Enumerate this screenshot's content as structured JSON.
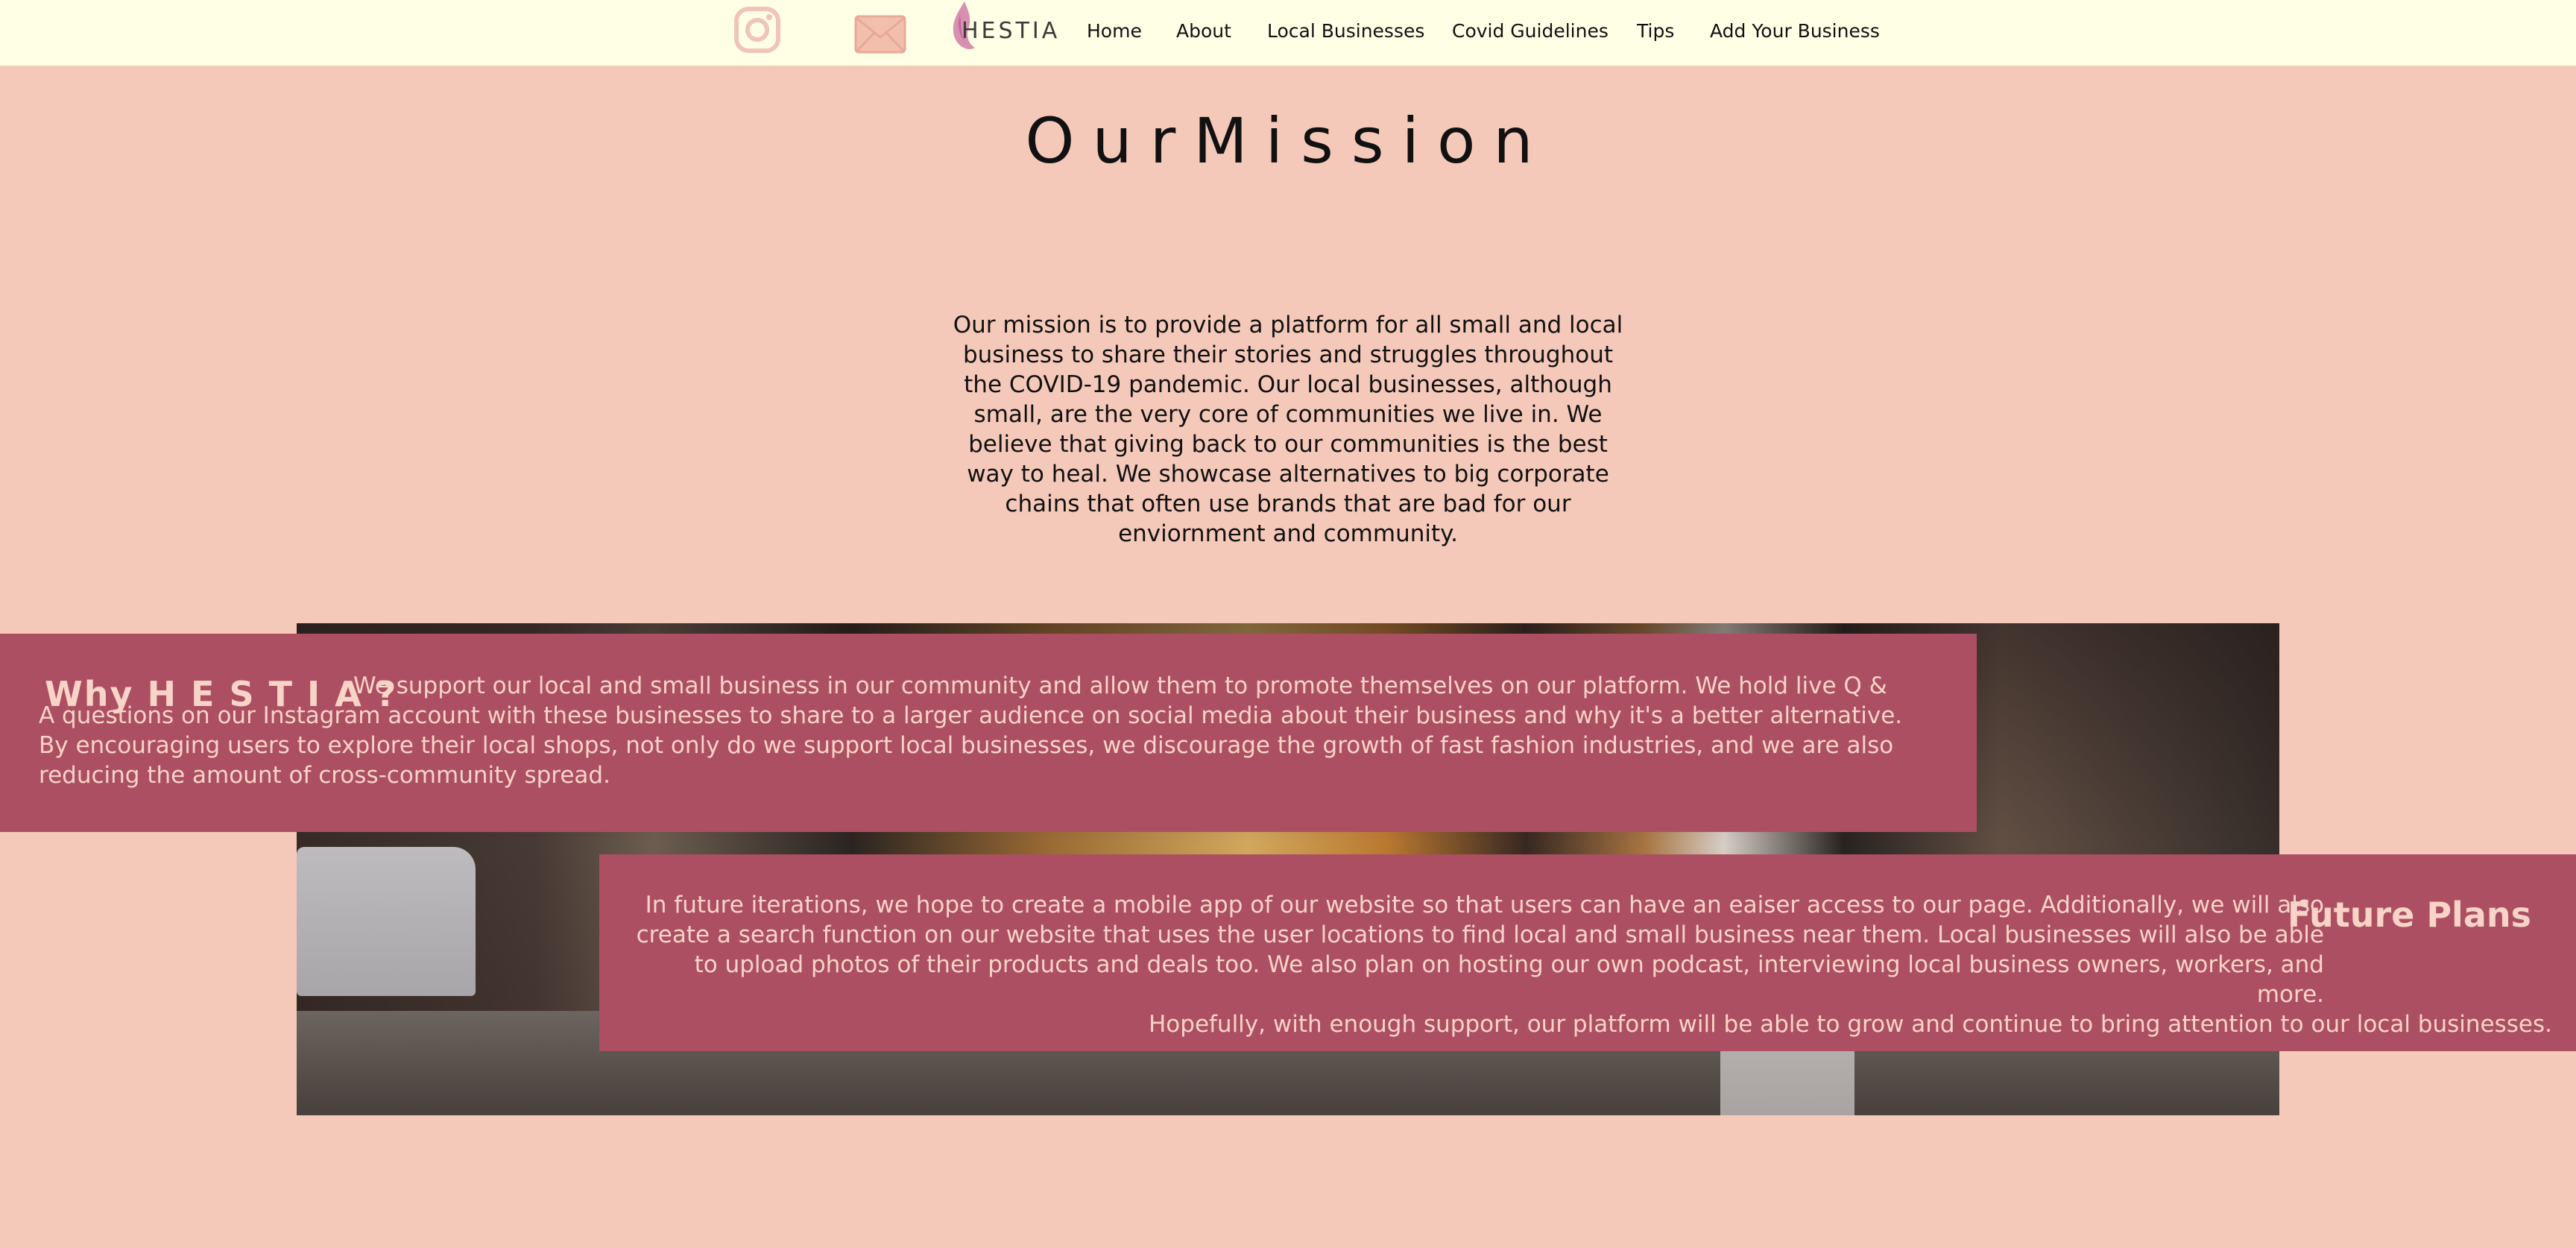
{
  "header": {
    "brand": "HESTIA",
    "nav": [
      "Home",
      "About",
      "Local Businesses",
      "Covid Guidelines",
      "Tips",
      "Add Your Business"
    ],
    "icons": [
      "instagram-icon",
      "mail-icon",
      "flame-logo-icon"
    ]
  },
  "mission": {
    "title": "OurMission",
    "text": "Our mission is to provide a platform for all small and local business to share their stories and struggles throughout the COVID-19 pandemic. Our local businesses, although small, are the very core of communities we live in. We believe that giving back to our communities is the best way to heal. We showcase alternatives to big corporate chains that often use brands that are bad for our enviornment and community."
  },
  "why": {
    "heading": "Why H E S T I A ?",
    "text": "We support our local and small business in our community and allow them to promote themselves on our platform. We hold live Q & A questions on our Instagram account with these businesses to share to a larger audience on social media about their business and why it's a better alternative. By encouraging users to explore their local shops, not only do we support local businesses, we discourage the growth of fast fashion industries, and we are also reducing the amount of cross-community spread."
  },
  "future": {
    "heading": "Future Plans",
    "text_main": "In future iterations, we hope to create a mobile app of our website so that users can have an eaiser access to our page. Additionally, we will also create a search function on our website that uses the user locations to find local and small business near them. Local businesses will also be able to upload photos of their products and deals too. We also plan on hosting our own podcast, interviewing local business owners, workers, and more.",
    "text_last": "Hopefully, with enough support, our platform will be able to grow and continue to bring attention to our local businesses."
  },
  "colors": {
    "page_bg": "#f5c9ba",
    "header_bg": "#ffffe6",
    "banner_bg": "#ac4f62",
    "banner_text": "#f8d3c8"
  }
}
